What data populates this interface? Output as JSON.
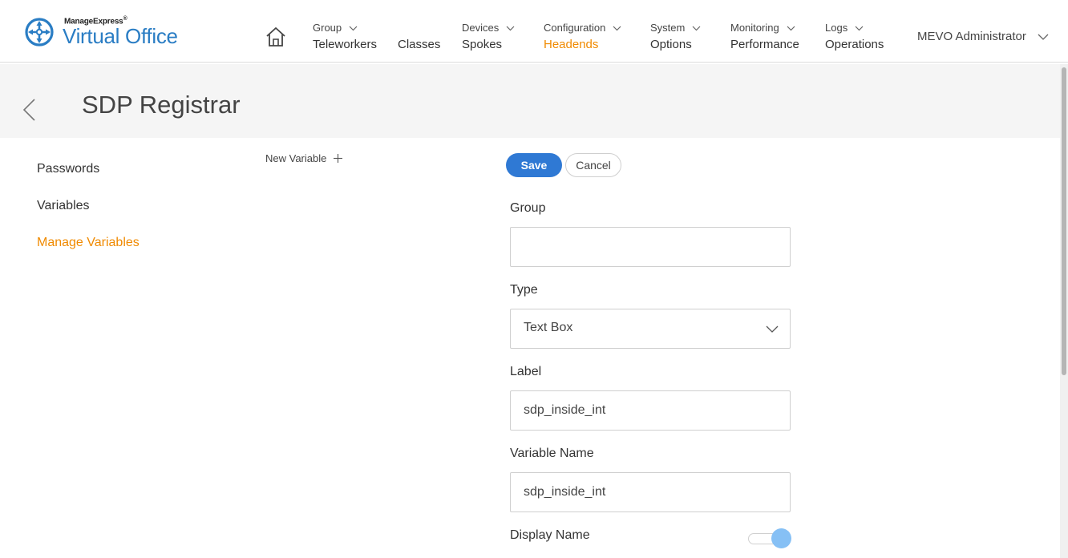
{
  "app": {
    "brand": "ManageExpress",
    "brand_mark": "®",
    "name": "Virtual Office"
  },
  "nav": {
    "home_icon": "home-icon",
    "items": [
      {
        "top": "Group",
        "bottom": "Teleworkers",
        "has_dropdown": true,
        "active": false
      },
      {
        "top": "",
        "bottom": "Classes",
        "has_dropdown": false,
        "active": false
      },
      {
        "top": "Devices",
        "bottom": "Spokes",
        "has_dropdown": true,
        "active": false
      },
      {
        "top": "Configuration",
        "bottom": "Headends",
        "has_dropdown": true,
        "active": true
      },
      {
        "top": "System",
        "bottom": "Options",
        "has_dropdown": true,
        "active": false
      },
      {
        "top": "Monitoring",
        "bottom": "Performance",
        "has_dropdown": true,
        "active": false
      },
      {
        "top": "Logs",
        "bottom": "Operations",
        "has_dropdown": true,
        "active": false
      }
    ],
    "user": "MEVO Administrator"
  },
  "page": {
    "title": "SDP Registrar"
  },
  "sidebar": {
    "items": [
      {
        "label": "Passwords",
        "active": false
      },
      {
        "label": "Variables",
        "active": false
      },
      {
        "label": "Manage Variables",
        "active": true
      }
    ]
  },
  "actions": {
    "new_variable": "New Variable",
    "save": "Save",
    "cancel": "Cancel"
  },
  "form": {
    "group": {
      "label": "Group",
      "value": ""
    },
    "type": {
      "label": "Type",
      "value": "Text Box"
    },
    "label": {
      "label": "Label",
      "value": "sdp_inside_int"
    },
    "variable_name": {
      "label": "Variable Name",
      "value": "sdp_inside_int"
    },
    "display_name": {
      "label": "Display Name",
      "enabled": true
    }
  },
  "colors": {
    "accent_orange": "#f08a00",
    "primary_blue": "#2f79d4",
    "logo_blue": "#2a7dc4",
    "toggle_knob": "#86c0f5"
  }
}
